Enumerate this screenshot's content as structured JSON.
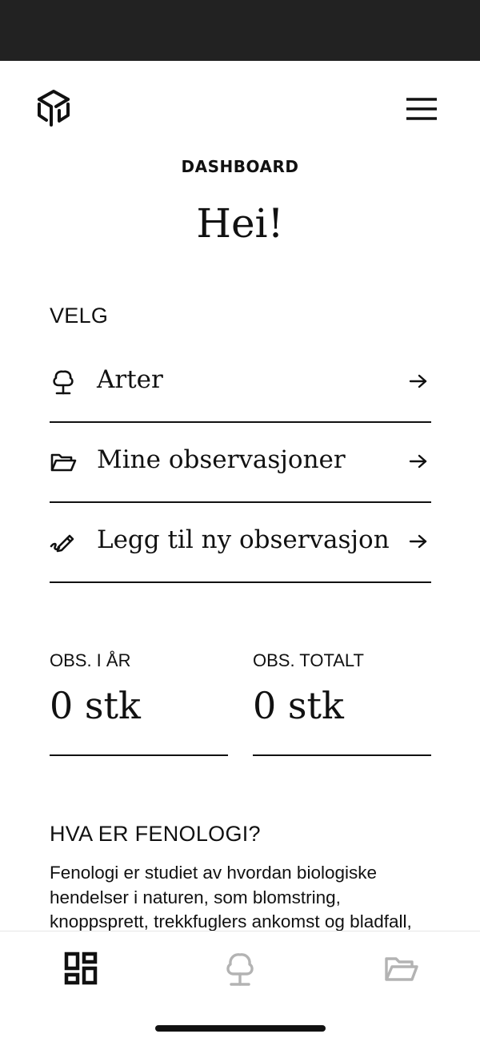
{
  "header": {
    "logo_icon": "cube-logo-icon",
    "menu_icon": "hamburger-menu-icon"
  },
  "page": {
    "label": "DASHBOARD",
    "greeting": "Hei!"
  },
  "choose": {
    "title": "VELG",
    "items": [
      {
        "label": "Arter",
        "icon": "tree-icon"
      },
      {
        "label": "Mine observasjoner",
        "icon": "folder-open-icon"
      },
      {
        "label": "Legg til ny observasjon",
        "icon": "pen-icon"
      }
    ]
  },
  "stats": {
    "year": {
      "label": "OBS. I ÅR",
      "value": "0 stk"
    },
    "total": {
      "label": "OBS. TOTALT",
      "value": "0 stk"
    }
  },
  "about": {
    "title": "HVA ER FENOLOGI?",
    "text": "Fenologi er studiet av hvordan biologiske hendelser i naturen, som blomstring, knoppsprett, trekkfuglers ankomst og bladfall,"
  },
  "tabbar": {
    "tabs": [
      {
        "name": "dashboard",
        "icon": "dashboard-grid-icon",
        "active": true
      },
      {
        "name": "arter",
        "icon": "tree-icon",
        "active": false
      },
      {
        "name": "observasjoner",
        "icon": "folder-open-icon",
        "active": false
      }
    ],
    "active_color": "#111111",
    "inactive_color": "#b3b3b3"
  }
}
